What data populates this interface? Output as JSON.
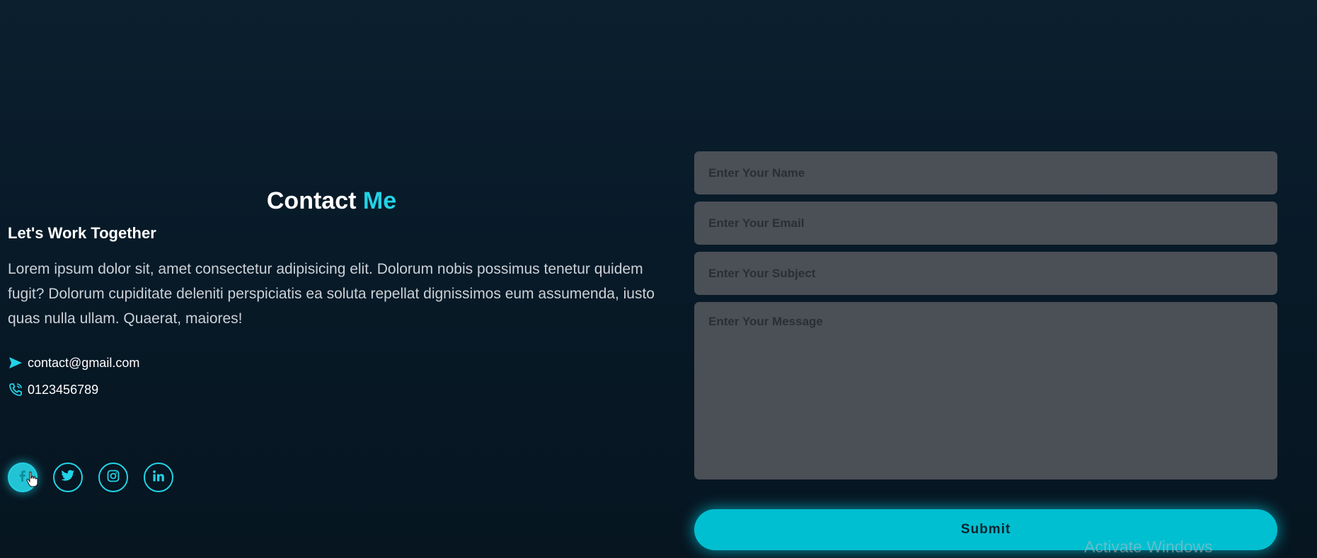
{
  "section": {
    "title_prefix": "Contact",
    "title_accent": "Me",
    "subtitle": "Let's Work Together",
    "description": "Lorem ipsum dolor sit, amet consectetur adipisicing elit. Dolorum nobis possimus tenetur quidem fugit? Dolorum cupiditate deleniti perspiciatis ea soluta repellat dignissimos eum assumenda, iusto quas nulla ullam. Quaerat, maiores!"
  },
  "contact": {
    "email": "contact@gmail.com",
    "phone": "0123456789",
    "email_icon": "send-icon",
    "phone_icon": "phone-icon"
  },
  "socials": [
    {
      "icon": "facebook-icon",
      "active": true
    },
    {
      "icon": "twitter-icon",
      "active": false
    },
    {
      "icon": "instagram-icon",
      "active": false
    },
    {
      "icon": "linkedin-icon",
      "active": false
    }
  ],
  "form": {
    "name_placeholder": "Enter Your Name",
    "email_placeholder": "Enter Your Email",
    "subject_placeholder": "Enter Your Subject",
    "message_placeholder": "Enter Your Message",
    "submit_label": "Submit"
  },
  "watermark": "Activate Windows",
  "colors": {
    "accent": "#22d3e6",
    "background": "#0b1f2e",
    "field": "#4b4f56",
    "button": "#00bfd0"
  }
}
